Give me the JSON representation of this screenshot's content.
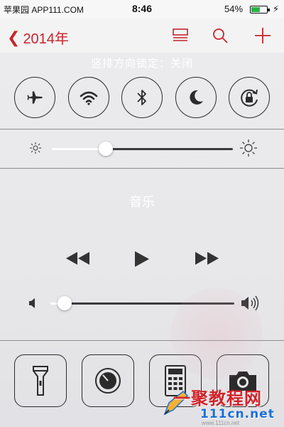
{
  "status_bar": {
    "carrier": "苹果园 APP111.COM",
    "time": "8:46",
    "battery": "54%",
    "battery_level": 0.54
  },
  "background_app": {
    "back_label": "2014年",
    "accent_color": "#c8252c"
  },
  "control_center": {
    "lock_message": "竖排方向锁定：关闭",
    "toggles": [
      {
        "name": "airplane-mode",
        "icon": "airplane-icon"
      },
      {
        "name": "wifi",
        "icon": "wifi-icon"
      },
      {
        "name": "bluetooth",
        "icon": "bluetooth-icon"
      },
      {
        "name": "do-not-disturb",
        "icon": "moon-icon"
      },
      {
        "name": "rotation-lock",
        "icon": "rotation-lock-icon"
      }
    ],
    "brightness": 0.3,
    "music": {
      "title": "音乐",
      "volume": 0.08
    },
    "shortcuts": [
      {
        "name": "flashlight",
        "icon": "flashlight-icon"
      },
      {
        "name": "timer",
        "icon": "timer-icon"
      },
      {
        "name": "calculator",
        "icon": "calculator-icon"
      },
      {
        "name": "camera",
        "icon": "camera-icon"
      }
    ]
  },
  "watermark": {
    "main": "一聚教程网",
    "site": "111cn.net",
    "sub": "www.111cn.net"
  }
}
